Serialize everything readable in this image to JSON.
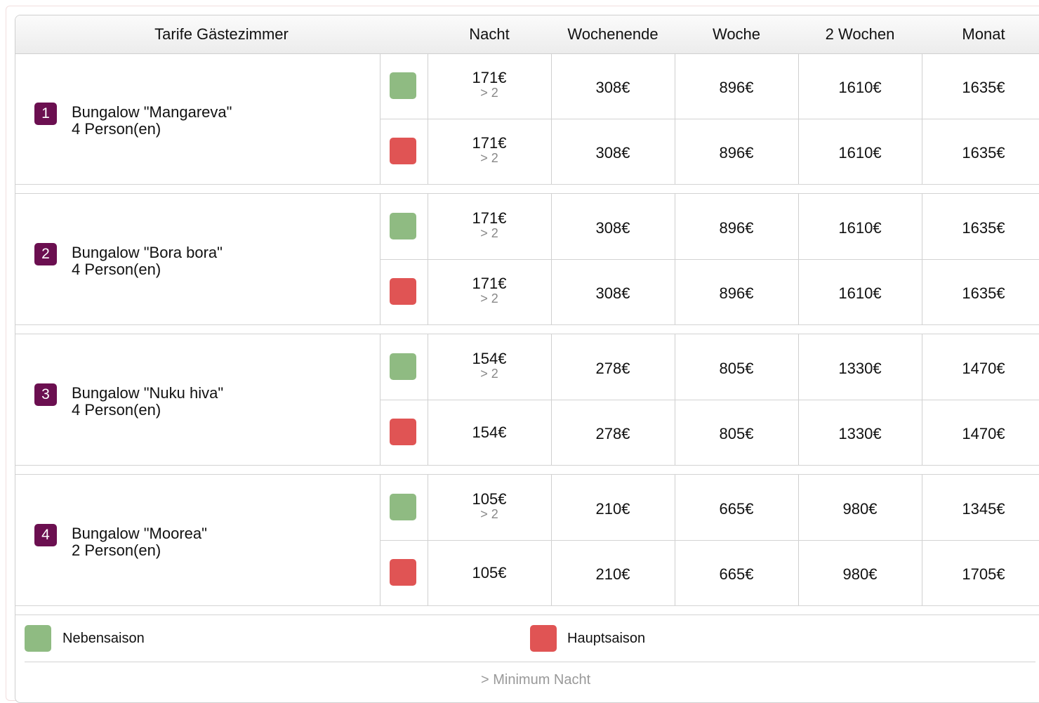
{
  "header": {
    "title": "Tarife Gästezimmer",
    "columns": [
      "Nacht",
      "Wochenende",
      "Woche",
      "2 Wochen",
      "Monat"
    ]
  },
  "rooms": [
    {
      "number": "1",
      "name": "Bungalow \"Mangareva\"",
      "persons": "4 Person(en)",
      "rows": [
        {
          "season": "Nebensaison",
          "night": "171€",
          "min": "> 2",
          "weekend": "308€",
          "week": "896€",
          "two_weeks": "1610€",
          "month": "1635€"
        },
        {
          "season": "Hauptsaison",
          "night": "171€",
          "min": "> 2",
          "weekend": "308€",
          "week": "896€",
          "two_weeks": "1610€",
          "month": "1635€"
        }
      ]
    },
    {
      "number": "2",
      "name": "Bungalow \"Bora bora\"",
      "persons": "4 Person(en)",
      "rows": [
        {
          "season": "Nebensaison",
          "night": "171€",
          "min": "> 2",
          "weekend": "308€",
          "week": "896€",
          "two_weeks": "1610€",
          "month": "1635€"
        },
        {
          "season": "Hauptsaison",
          "night": "171€",
          "min": "> 2",
          "weekend": "308€",
          "week": "896€",
          "two_weeks": "1610€",
          "month": "1635€"
        }
      ]
    },
    {
      "number": "3",
      "name": "Bungalow \"Nuku hiva\"",
      "persons": "4 Person(en)",
      "rows": [
        {
          "season": "Nebensaison",
          "night": "154€",
          "min": "> 2",
          "weekend": "278€",
          "week": "805€",
          "two_weeks": "1330€",
          "month": "1470€"
        },
        {
          "season": "Hauptsaison",
          "night": "154€",
          "min": "",
          "weekend": "278€",
          "week": "805€",
          "two_weeks": "1330€",
          "month": "1470€"
        }
      ]
    },
    {
      "number": "4",
      "name": "Bungalow \"Moorea\"",
      "persons": "2 Person(en)",
      "rows": [
        {
          "season": "Nebensaison",
          "night": "105€",
          "min": "> 2",
          "weekend": "210€",
          "week": "665€",
          "two_weeks": "980€",
          "month": "1345€"
        },
        {
          "season": "Hauptsaison",
          "night": "105€",
          "min": "",
          "weekend": "210€",
          "week": "665€",
          "two_weeks": "980€",
          "month": "1705€"
        }
      ]
    }
  ],
  "legend": {
    "low_season": "Nebensaison",
    "high_season": "Hauptsaison",
    "footnote": "> Minimum Nacht"
  },
  "colors": {
    "low_season": "#8fbb82",
    "high_season": "#e05454",
    "badge": "#6b0f50"
  }
}
